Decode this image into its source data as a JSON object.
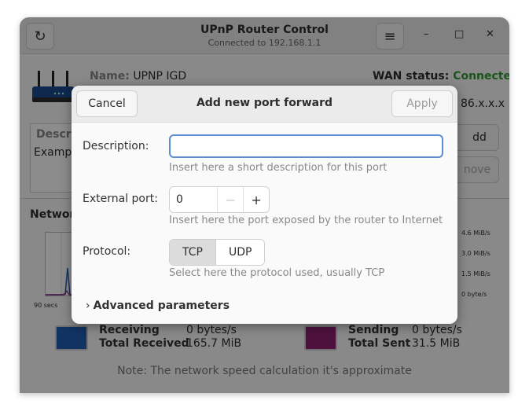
{
  "window": {
    "title": "UPnP Router Control",
    "subtitle": "Connected to 192.168.1.1",
    "refresh_icon": "refresh-icon",
    "menu_icon": "hamburger-menu-icon",
    "minimize": "–",
    "maximize": "□",
    "close": "✕"
  },
  "background": {
    "name_label": "Name:",
    "name_value": "UPNP IGD",
    "wan_label": "WAN status:",
    "wan_value": "Connected",
    "ip_partial": "86.x.x.x",
    "list_header_partial": "Descri",
    "list_row_partial": "Exampl",
    "add_partial": "dd",
    "remove_partial": "nove",
    "network_partial": "Networ",
    "graph_time": "90 secs",
    "scale": [
      "4.6 MiB/s",
      "3.0 MiB/s",
      "1.5 MiB/s",
      "0 byte/s"
    ],
    "receiving_label": "Receiving",
    "receiving_value": "0 bytes/s",
    "total_received_label": "Total Received",
    "total_received_value": "165.7 MiB",
    "sending_label": "Sending",
    "sending_value": "0 bytes/s",
    "total_sent_label": "Total Sent",
    "total_sent_value": "31.5 MiB",
    "note": "Note: The network speed calculation it's approximate",
    "colors": {
      "receiving": "#1f5db5",
      "sending": "#8e1f72",
      "wan_ok": "#2e9b2e"
    }
  },
  "dialog": {
    "title": "Add new port forward",
    "cancel_label": "Cancel",
    "apply_label": "Apply",
    "description_label": "Description:",
    "description_value": "",
    "description_hint": "Insert here a short description for this port",
    "external_port_label": "External port:",
    "external_port_value": "0",
    "external_port_hint": "Insert here the port exposed by the router to Internet",
    "decrement": "−",
    "increment": "+",
    "protocol_label": "Protocol:",
    "protocol_options": [
      "TCP",
      "UDP"
    ],
    "protocol_selected": "TCP",
    "protocol_hint": "Select here the protocol used, usually TCP",
    "advanced_label": "Advanced parameters",
    "advanced_icon": "chevron-right-icon"
  }
}
